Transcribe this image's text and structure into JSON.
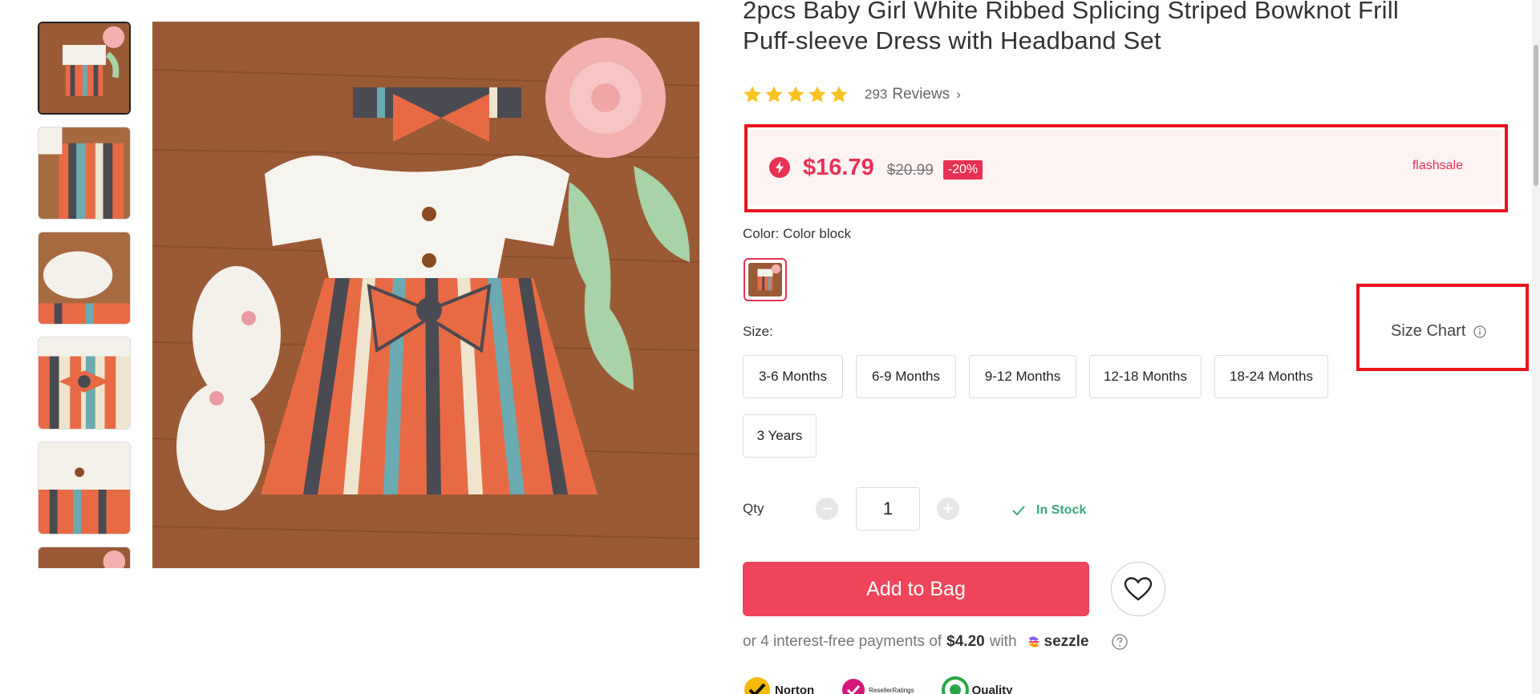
{
  "product": {
    "title_line1": "2pcs Baby Girl White Ribbed Splicing Striped Bowknot Frill",
    "title_line2": "Puff-sleeve Dress with Headband Set"
  },
  "rating": {
    "stars": 5,
    "count": "293",
    "label": "Reviews",
    "chevron": "›"
  },
  "price": {
    "current": "$16.79",
    "original": "$20.99",
    "discount": "-20%",
    "flash_label": "flashsale",
    "accent_color": "#e83254"
  },
  "color": {
    "label": "Color: Color block"
  },
  "size": {
    "label": "Size:",
    "options": [
      "3-6 Months",
      "6-9 Months",
      "9-12 Months",
      "12-18 Months",
      "18-24 Months",
      "3 Years"
    ],
    "chart_label": "Size Chart"
  },
  "qty": {
    "label": "Qty",
    "value": "1",
    "minus": "−",
    "plus": "+",
    "stock": "In Stock",
    "stock_color": "#3aa879"
  },
  "actions": {
    "add_to_bag": "Add to Bag"
  },
  "payment": {
    "prefix": "or 4 interest-free payments of",
    "amount": "$4.20",
    "suffix": "with",
    "provider": "sezzle"
  },
  "badges": [
    "Norton",
    "ResellerRatings",
    "Quality"
  ]
}
